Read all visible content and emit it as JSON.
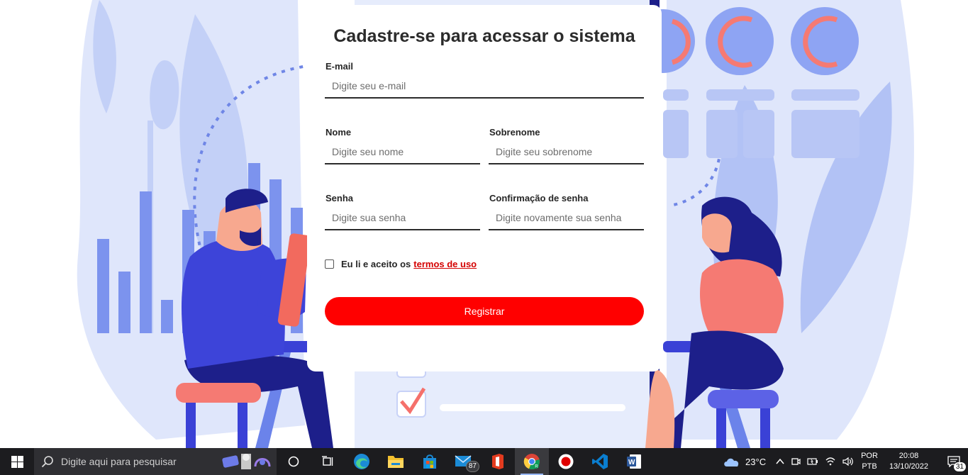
{
  "form": {
    "title": "Cadastre-se para acessar o sistema",
    "email": {
      "label": "E-mail",
      "placeholder": "Digite seu e-mail",
      "value": ""
    },
    "first_name": {
      "label": "Nome",
      "placeholder": "Digite seu nome",
      "value": ""
    },
    "last_name": {
      "label": "Sobrenome",
      "placeholder": "Digite seu sobrenome",
      "value": ""
    },
    "password": {
      "label": "Senha",
      "placeholder": "Digite sua senha",
      "value": ""
    },
    "password_confirm": {
      "label": "Confirmação de senha",
      "placeholder": "Digite novamente sua senha",
      "value": ""
    },
    "terms": {
      "text": "Eu li e aceito os",
      "link": "termos de uso",
      "checked": false
    },
    "submit_label": "Registrar"
  },
  "colors": {
    "accent": "#ff0000",
    "illustration_blue": "#3d44d9",
    "illustration_light": "#dfe6fb",
    "taskbar": "#1c1c1f"
  },
  "taskbar": {
    "search_placeholder": "Digite aqui para pesquisar",
    "apps": [
      {
        "icon": "task-view-circle-icon"
      },
      {
        "icon": "task-view-icon"
      },
      {
        "icon": "edge-icon"
      },
      {
        "icon": "file-explorer-icon"
      },
      {
        "icon": "microsoft-store-icon"
      },
      {
        "icon": "mail-icon",
        "badge": "87"
      },
      {
        "icon": "office-icon"
      },
      {
        "icon": "chrome-icon",
        "active": true
      },
      {
        "icon": "record-icon"
      },
      {
        "icon": "vscode-icon"
      },
      {
        "icon": "word-icon"
      }
    ],
    "weather": "23°C",
    "language": {
      "line1": "POR",
      "line2": "PTB"
    },
    "time": "20:08",
    "date": "13/10/2022",
    "notifications": "31"
  }
}
